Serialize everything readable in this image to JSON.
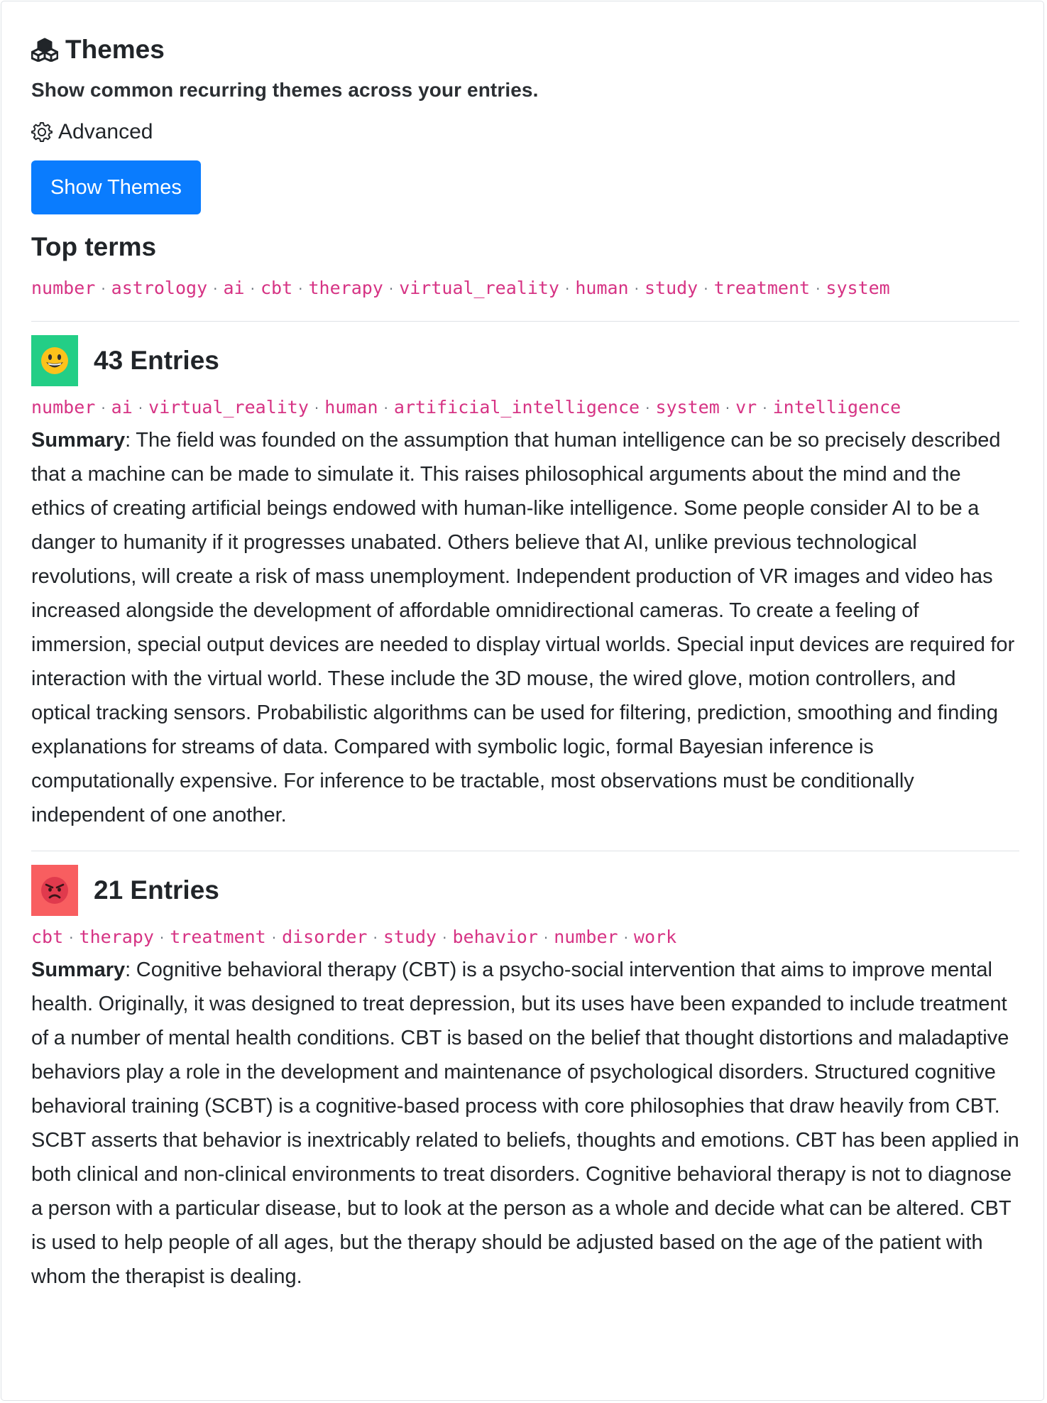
{
  "header": {
    "title": "Themes",
    "subtitle": "Show common recurring themes across your entries.",
    "advanced_label": "Advanced",
    "show_button": "Show Themes"
  },
  "top_terms": {
    "title": "Top terms",
    "terms": [
      "number",
      "astrology",
      "ai",
      "cbt",
      "therapy",
      "virtual_reality",
      "human",
      "study",
      "treatment",
      "system"
    ]
  },
  "clusters": [
    {
      "emoji": "grinning-face-icon",
      "badge_color": "#23ce86",
      "count_label": "43 Entries",
      "terms": [
        "number",
        "ai",
        "virtual_reality",
        "human",
        "artificial_intelligence",
        "system",
        "vr",
        "intelligence"
      ],
      "summary_label": "Summary",
      "summary": "The field was founded on the assumption that human intelligence can be so precisely described that a machine can be made to simulate it. This raises philosophical arguments about the mind and the ethics of creating artificial beings endowed with human-like intelligence. Some people consider AI to be a danger to humanity if it progresses unabated. Others believe that AI, unlike previous technological revolutions, will create a risk of mass unemployment. Independent production of VR images and video has increased alongside the development of affordable omnidirectional cameras. To create a feeling of immersion, special output devices are needed to display virtual worlds. Special input devices are required for interaction with the virtual world. These include the 3D mouse, the wired glove, motion controllers, and optical tracking sensors. Probabilistic algorithms can be used for filtering, prediction, smoothing and finding explanations for streams of data. Compared with symbolic logic, formal Bayesian inference is computationally expensive. For inference to be tractable, most observations must be conditionally independent of one another."
    },
    {
      "emoji": "angry-face-icon",
      "badge_color": "#f85e60",
      "count_label": "21 Entries",
      "terms": [
        "cbt",
        "therapy",
        "treatment",
        "disorder",
        "study",
        "behavior",
        "number",
        "work"
      ],
      "summary_label": "Summary",
      "summary": "Cognitive behavioral therapy (CBT) is a psycho-social intervention that aims to improve mental health. Originally, it was designed to treat depression, but its uses have been expanded to include treatment of a number of mental health conditions. CBT is based on the belief that thought distortions and maladaptive behaviors play a role in the development and maintenance of psychological disorders. Structured cognitive behavioral training (SCBT) is a cognitive-based process with core philosophies that draw heavily from CBT. SCBT asserts that behavior is inextricably related to beliefs, thoughts and emotions. CBT has been applied in both clinical and non-clinical environments to treat disorders. Cognitive behavioral therapy is not to diagnose a person with a particular disease, but to look at the person as a whole and decide what can be altered. CBT is used to help people of all ages, but the therapy should be adjusted based on the age of the patient with whom the therapist is dealing."
    }
  ],
  "colors": {
    "accent": "#0a7cfe",
    "term": "#d63384",
    "positive": "#23ce86",
    "negative": "#f85e60"
  }
}
